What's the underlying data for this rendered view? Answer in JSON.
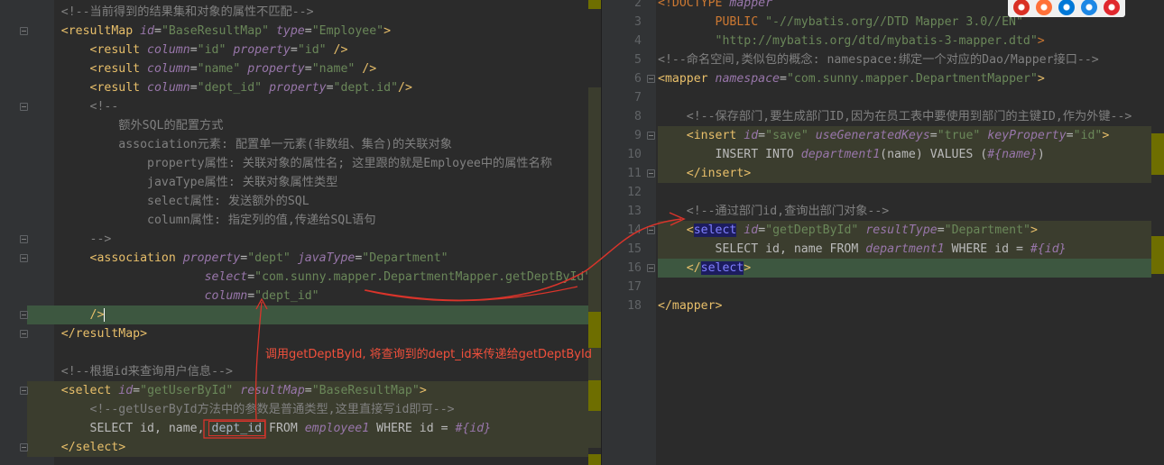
{
  "left_editor": {
    "lines": [
      {
        "fold": false,
        "bg": null,
        "segs": [
          [
            "c",
            "    <!--当前得到的结果集和对象的属性不匹配-->"
          ]
        ]
      },
      {
        "fold": true,
        "bg": null,
        "segs": [
          [
            "t",
            "    <resultMap "
          ],
          [
            "ai",
            "id"
          ],
          [
            "a",
            "="
          ],
          [
            "v",
            "\"BaseResultMap\""
          ],
          [
            "t",
            " "
          ],
          [
            "ai",
            "type"
          ],
          [
            "a",
            "="
          ],
          [
            "v",
            "\"Employee\""
          ],
          [
            "t",
            ">"
          ]
        ]
      },
      {
        "fold": false,
        "bg": null,
        "segs": [
          [
            "t",
            "        <result "
          ],
          [
            "ai",
            "column"
          ],
          [
            "a",
            "="
          ],
          [
            "v",
            "\"id\""
          ],
          [
            "t",
            " "
          ],
          [
            "ai",
            "property"
          ],
          [
            "a",
            "="
          ],
          [
            "v",
            "\"id\""
          ],
          [
            "t",
            " />"
          ]
        ]
      },
      {
        "fold": false,
        "bg": null,
        "segs": [
          [
            "t",
            "        <result "
          ],
          [
            "ai",
            "column"
          ],
          [
            "a",
            "="
          ],
          [
            "v",
            "\"name\""
          ],
          [
            "t",
            " "
          ],
          [
            "ai",
            "property"
          ],
          [
            "a",
            "="
          ],
          [
            "v",
            "\"name\""
          ],
          [
            "t",
            " />"
          ]
        ]
      },
      {
        "fold": false,
        "bg": null,
        "segs": [
          [
            "t",
            "        <result "
          ],
          [
            "ai",
            "column"
          ],
          [
            "a",
            "="
          ],
          [
            "v",
            "\"dept_id\""
          ],
          [
            "t",
            " "
          ],
          [
            "ai",
            "property"
          ],
          [
            "a",
            "="
          ],
          [
            "v",
            "\"dept.id\""
          ],
          [
            "t",
            "/>"
          ]
        ]
      },
      {
        "fold": true,
        "bg": null,
        "segs": [
          [
            "c",
            "        <!--"
          ]
        ]
      },
      {
        "fold": false,
        "bg": null,
        "segs": [
          [
            "c",
            "            额外SQL的配置方式"
          ]
        ]
      },
      {
        "fold": false,
        "bg": null,
        "segs": [
          [
            "c",
            "            association元素: 配置单一元素(非数组、集合)的关联对象"
          ]
        ]
      },
      {
        "fold": false,
        "bg": null,
        "segs": [
          [
            "c",
            "                property属性: 关联对象的属性名; 这里跟的就是Employee中的属性名称"
          ]
        ]
      },
      {
        "fold": false,
        "bg": null,
        "segs": [
          [
            "c",
            "                javaType属性: 关联对象属性类型"
          ]
        ]
      },
      {
        "fold": false,
        "bg": null,
        "segs": [
          [
            "c",
            "                select属性: 发送额外的SQL"
          ]
        ]
      },
      {
        "fold": false,
        "bg": null,
        "segs": [
          [
            "c",
            "                column属性: 指定列的值,传递给SQL语句"
          ]
        ]
      },
      {
        "fold": true,
        "bg": null,
        "segs": [
          [
            "c",
            "        -->"
          ]
        ]
      },
      {
        "fold": true,
        "bg": null,
        "segs": [
          [
            "t",
            "        <association "
          ],
          [
            "ai",
            "property"
          ],
          [
            "a",
            "="
          ],
          [
            "v",
            "\"dept\""
          ],
          [
            "t",
            " "
          ],
          [
            "ai",
            "javaType"
          ],
          [
            "a",
            "="
          ],
          [
            "v",
            "\"Department\""
          ]
        ]
      },
      {
        "fold": false,
        "bg": null,
        "segs": [
          [
            "t",
            "                        "
          ],
          [
            "ai",
            "select"
          ],
          [
            "a",
            "="
          ],
          [
            "v",
            "\"com.sunny.mapper.DepartmentMapper.getDeptById\""
          ]
        ]
      },
      {
        "fold": false,
        "bg": null,
        "segs": [
          [
            "t",
            "                        "
          ],
          [
            "ai",
            "column"
          ],
          [
            "a",
            "="
          ],
          [
            "v",
            "\"dept_id\""
          ]
        ]
      },
      {
        "fold": true,
        "bg": "#3d5740",
        "segs": [
          [
            "t",
            "        />"
          ],
          [
            "caret",
            ""
          ]
        ]
      },
      {
        "fold": true,
        "bg": null,
        "segs": [
          [
            "t",
            "    </resultMap>"
          ]
        ]
      },
      {
        "fold": false,
        "bg": null,
        "segs": [
          [
            "t",
            ""
          ]
        ]
      },
      {
        "fold": false,
        "bg": null,
        "segs": [
          [
            "c",
            "    <!--根据id来查询用户信息-->"
          ]
        ]
      },
      {
        "fold": true,
        "bg": "#3b3d2e",
        "segs": [
          [
            "t",
            "    <select "
          ],
          [
            "ai",
            "id"
          ],
          [
            "a",
            "="
          ],
          [
            "v",
            "\"getUserById\""
          ],
          [
            "t",
            " "
          ],
          [
            "ai",
            "resultMap"
          ],
          [
            "a",
            "="
          ],
          [
            "v",
            "\"BaseResultMap\""
          ],
          [
            "t",
            ">"
          ]
        ]
      },
      {
        "fold": false,
        "bg": "#3b3d2e",
        "segs": [
          [
            "c",
            "        <!--getUserById方法中的参数是普通类型,这里直接写id即可-->"
          ]
        ]
      },
      {
        "fold": false,
        "bg": "#3b3d2e",
        "segs": [
          [
            "a",
            "        SELECT id, name, "
          ],
          [
            "box",
            "dept_id"
          ],
          [
            "a",
            " FROM "
          ],
          [
            "ai",
            "employee1"
          ],
          [
            "a",
            " WHERE id = "
          ],
          [
            "pl",
            "#{id}"
          ]
        ]
      },
      {
        "fold": true,
        "bg": "#3b3d2e",
        "segs": [
          [
            "t",
            "    </select>"
          ]
        ]
      }
    ]
  },
  "right_editor": {
    "lines": [
      {
        "num": "2",
        "fold": false,
        "bg": null,
        "segs": [
          [
            "ck",
            "<!DOCTYPE "
          ],
          [
            "ai",
            "mapper"
          ]
        ]
      },
      {
        "num": "3",
        "fold": false,
        "bg": null,
        "segs": [
          [
            "ck",
            "        PUBLIC "
          ],
          [
            "v",
            "\"-//mybatis.org//DTD Mapper 3.0//EN\""
          ]
        ]
      },
      {
        "num": "4",
        "fold": false,
        "bg": null,
        "segs": [
          [
            "v",
            "        \"http://mybatis.org/dtd/mybatis-3-mapper.dtd\""
          ],
          [
            "ck",
            ">"
          ]
        ]
      },
      {
        "num": "5",
        "fold": false,
        "bg": null,
        "segs": [
          [
            "c",
            "<!--命名空间,类似包的概念: namespace:绑定一个对应的Dao/Mapper接口-->"
          ]
        ]
      },
      {
        "num": "6",
        "fold": true,
        "bg": null,
        "segs": [
          [
            "t",
            "<mapper "
          ],
          [
            "ai",
            "namespace"
          ],
          [
            "a",
            "="
          ],
          [
            "v",
            "\"com.sunny.mapper.DepartmentMapper\""
          ],
          [
            "t",
            ">"
          ]
        ]
      },
      {
        "num": "7",
        "fold": false,
        "bg": null,
        "segs": [
          [
            "t",
            ""
          ]
        ]
      },
      {
        "num": "8",
        "fold": false,
        "bg": null,
        "segs": [
          [
            "c",
            "    <!--保存部门,要生成部门ID,因为在员工表中要使用到部门的主键ID,作为外键-->"
          ]
        ]
      },
      {
        "num": "9",
        "fold": true,
        "bg": "#3b3d2e",
        "segs": [
          [
            "t",
            "    <insert "
          ],
          [
            "ai",
            "id"
          ],
          [
            "a",
            "="
          ],
          [
            "v",
            "\"save\""
          ],
          [
            "t",
            " "
          ],
          [
            "ai",
            "useGeneratedKeys"
          ],
          [
            "a",
            "="
          ],
          [
            "v",
            "\"true\""
          ],
          [
            "t",
            " "
          ],
          [
            "ai",
            "keyProperty"
          ],
          [
            "a",
            "="
          ],
          [
            "v",
            "\"id\""
          ],
          [
            "t",
            ">"
          ]
        ]
      },
      {
        "num": "10",
        "fold": false,
        "bg": "#3b3d2e",
        "segs": [
          [
            "a",
            "        INSERT INTO "
          ],
          [
            "ai",
            "department1"
          ],
          [
            "a",
            "(name) VALUES ("
          ],
          [
            "pl",
            "#{name}"
          ],
          [
            "a",
            ")"
          ]
        ]
      },
      {
        "num": "11",
        "fold": true,
        "bg": "#3b3d2e",
        "segs": [
          [
            "t",
            "    </insert>"
          ]
        ]
      },
      {
        "num": "12",
        "fold": false,
        "bg": null,
        "segs": [
          [
            "t",
            ""
          ]
        ]
      },
      {
        "num": "13",
        "fold": false,
        "bg": null,
        "segs": [
          [
            "c",
            "    <!--通过部门id,查询出部门对象-->"
          ]
        ]
      },
      {
        "num": "14",
        "fold": true,
        "bg": "#3b3d2e",
        "segs": [
          [
            "t",
            "    <"
          ],
          [
            "sel",
            "select"
          ],
          [
            "t",
            " "
          ],
          [
            "ai",
            "id"
          ],
          [
            "a",
            "="
          ],
          [
            "v",
            "\"getDeptById\""
          ],
          [
            "t",
            " "
          ],
          [
            "ai",
            "resultType"
          ],
          [
            "a",
            "="
          ],
          [
            "v",
            "\"Department\""
          ],
          [
            "t",
            ">"
          ]
        ]
      },
      {
        "num": "15",
        "fold": false,
        "bg": "#3b3d2e",
        "segs": [
          [
            "a",
            "        SELECT id, name FROM "
          ],
          [
            "ai",
            "department1"
          ],
          [
            "a",
            " WHERE id = "
          ],
          [
            "pl",
            "#{id}"
          ]
        ]
      },
      {
        "num": "16",
        "fold": true,
        "bg": "#3d5740",
        "segs": [
          [
            "t",
            "    </"
          ],
          [
            "sel",
            "select"
          ],
          [
            "t",
            ">"
          ]
        ]
      },
      {
        "num": "17",
        "fold": false,
        "bg": null,
        "segs": [
          [
            "t",
            ""
          ]
        ]
      },
      {
        "num": "18",
        "fold": false,
        "bg": null,
        "segs": [
          [
            "t",
            "</mapper>"
          ]
        ]
      }
    ]
  },
  "annotation": {
    "text": "调用getDeptById, 将查询到的dept_id来传递给getDeptById",
    "color": "#f0503c"
  },
  "browser_icons": [
    "chrome-icon",
    "firefox-icon",
    "edge-icon",
    "safari-icon",
    "opera-icon"
  ],
  "colors": {
    "tag": "#e8bf6a",
    "attribute": "#9876aa",
    "string": "#6a8759",
    "comment": "#808080",
    "current_line": "#3d5740",
    "scope_highlight": "#3b3d2e",
    "annotation_red": "#f0503c"
  }
}
